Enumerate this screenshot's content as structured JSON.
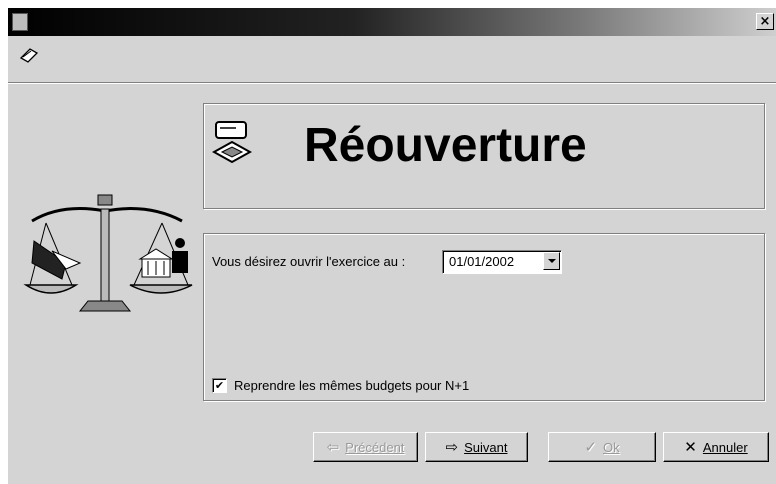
{
  "window": {
    "close_glyph": "×"
  },
  "toolbar": {
    "icon": "edit-icon"
  },
  "title": {
    "text": "Réouverture",
    "icon": "cash-register-icon"
  },
  "illustration": {
    "icon": "scales-of-justice-icon"
  },
  "form": {
    "exercise_label": "Vous désirez ouvrir l'exercice au :",
    "exercise_value": "01/01/2002",
    "budgets_checkbox_label": "Reprendre les mêmes budgets pour N+1",
    "budgets_checked": true
  },
  "buttons": {
    "previous": {
      "label": "Précédent",
      "icon": "⇦",
      "enabled": false
    },
    "next": {
      "label": "Suivant",
      "icon": "⇨",
      "enabled": true
    },
    "ok": {
      "label": "Ok",
      "icon": "✓",
      "enabled": false
    },
    "cancel": {
      "label": "Annuler",
      "icon": "✕",
      "enabled": true
    }
  }
}
